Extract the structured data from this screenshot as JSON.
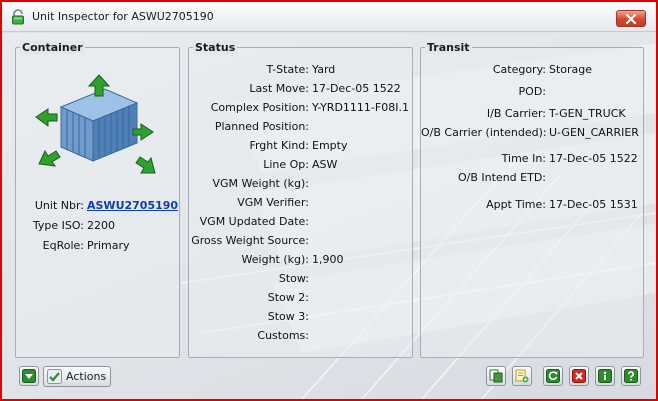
{
  "window": {
    "title": "Unit Inspector for ASWU2705190",
    "close_icon": "close-icon",
    "title_icon": "padlock-icon"
  },
  "container": {
    "title": "Container",
    "unit_nbr_label": "Unit Nbr:",
    "unit_nbr_value": "ASWU2705190",
    "type_iso_label": "Type ISO:",
    "type_iso_value": "2200",
    "eqrole_label": "EqRole:",
    "eqrole_value": "Primary"
  },
  "status": {
    "title": "Status",
    "rows": [
      {
        "label": "T-State:",
        "value": "Yard"
      },
      {
        "label": "Last Move:",
        "value": "17-Dec-05 1522"
      },
      {
        "label": "Complex Position:",
        "value": "Y-YRD1111-F08I.1"
      },
      {
        "label": "Planned Position:",
        "value": ""
      },
      {
        "label": "Frght Kind:",
        "value": "Empty"
      },
      {
        "label": "Line Op:",
        "value": "ASW"
      },
      {
        "label": "VGM Weight (kg):",
        "value": ""
      },
      {
        "label": "VGM Verifier:",
        "value": ""
      },
      {
        "label": "VGM Updated Date:",
        "value": ""
      },
      {
        "label": "Gross Weight Source:",
        "value": ""
      },
      {
        "label": "Weight (kg):",
        "value": "1,900"
      },
      {
        "label": "Stow:",
        "value": ""
      },
      {
        "label": "Stow 2:",
        "value": ""
      },
      {
        "label": "Stow 3:",
        "value": ""
      },
      {
        "label": "Customs:",
        "value": ""
      }
    ]
  },
  "transit": {
    "title": "Transit",
    "rows": [
      {
        "label": "Category:",
        "value": "Storage"
      },
      {
        "label": "POD:",
        "value": ""
      },
      {
        "label": "I/B Carrier:",
        "value": "T-GEN_TRUCK"
      },
      {
        "label": "O/B Carrier (intended):",
        "value": "U-GEN_CARRIER"
      },
      {
        "label": "Time In:",
        "value": "17-Dec-05 1522"
      },
      {
        "label": "O/B Intend ETD:",
        "value": ""
      },
      {
        "label": "Appt Time:",
        "value": "17-Dec-05 1531"
      }
    ]
  },
  "toolbar": {
    "actions_label": "Actions",
    "icons": [
      "dropdown-arrow-icon",
      "copy-icon",
      "add-note-icon",
      "refresh-icon",
      "delete-icon",
      "info-icon",
      "help-icon"
    ]
  },
  "colors": {
    "window_border": "#e00000",
    "accent_green": "#2e8b2e",
    "delete_red": "#d02a1a",
    "container_blue": "#5f8fc3",
    "link_blue": "#0e3fb0"
  }
}
